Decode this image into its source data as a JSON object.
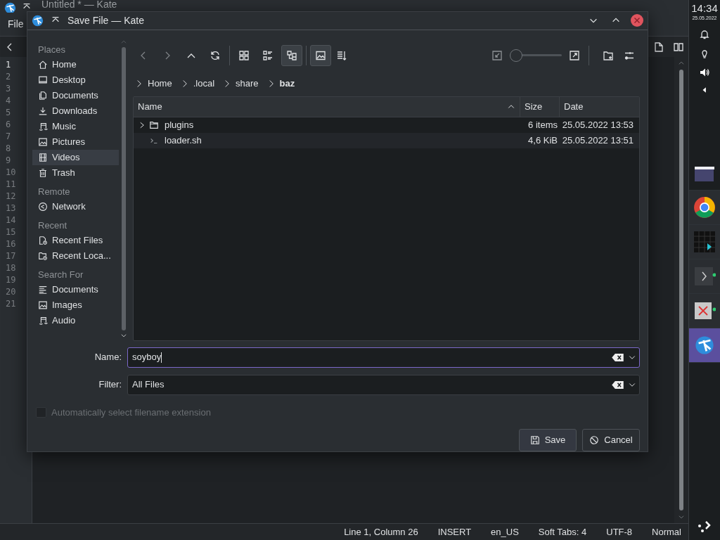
{
  "background_window": {
    "title": "Untitled * — Kate",
    "menu": [
      "File"
    ],
    "line_numbers": [
      "1",
      "2",
      "3",
      "4",
      "5",
      "6",
      "7",
      "8",
      "9",
      "10",
      "11",
      "12",
      "13",
      "14",
      "15",
      "16",
      "17",
      "18",
      "19",
      "20",
      "21"
    ],
    "status_bar": [
      "Line 1, Column 26",
      "INSERT",
      "en_US",
      "Soft Tabs: 4",
      "UTF-8",
      "Normal"
    ]
  },
  "tray": {
    "time": "14:34",
    "date": "25.05.2022"
  },
  "launchers": [
    {
      "active": false
    },
    {
      "active": false
    },
    {
      "active": false
    },
    {
      "active": false
    },
    {
      "active": false
    },
    {
      "active": true
    }
  ],
  "dialog": {
    "title": "Save File — Kate",
    "places": [
      {
        "heading": "Places",
        "items": [
          {
            "label": "Home",
            "hovered": false
          },
          {
            "label": "Desktop",
            "hovered": false
          },
          {
            "label": "Documents",
            "hovered": false
          },
          {
            "label": "Downloads",
            "hovered": false
          },
          {
            "label": "Music",
            "hovered": false
          },
          {
            "label": "Pictures",
            "hovered": false
          },
          {
            "label": "Videos",
            "hovered": true
          },
          {
            "label": "Trash",
            "hovered": false
          }
        ]
      },
      {
        "heading": "Remote",
        "items": [
          {
            "label": "Network",
            "hovered": false
          }
        ]
      },
      {
        "heading": "Recent",
        "items": [
          {
            "label": "Recent Files",
            "hovered": false
          },
          {
            "label": "Recent Loca...",
            "hovered": false
          }
        ]
      },
      {
        "heading": "Search For",
        "items": [
          {
            "label": "Documents",
            "hovered": false
          },
          {
            "label": "Images",
            "hovered": false
          },
          {
            "label": "Audio",
            "hovered": false
          }
        ]
      }
    ],
    "view_buttons": [
      {
        "pressed": false
      },
      {
        "pressed": false
      },
      {
        "pressed": true
      }
    ],
    "preview_pressed": true,
    "zoom": {
      "level": 0
    },
    "breadcrumb": [
      {
        "label": "Home",
        "current": false
      },
      {
        "label": ".local",
        "current": false
      },
      {
        "label": "share",
        "current": false
      },
      {
        "label": "baz",
        "current": true
      }
    ],
    "columns": [
      {
        "label": "Name",
        "sorted": true
      },
      {
        "label": "Size",
        "sorted": false
      },
      {
        "label": "Date",
        "sorted": false
      }
    ],
    "rows": [
      {
        "kind": "folder",
        "name": "plugins",
        "expanded": false,
        "size": "6 items",
        "date": "25.05.2022 13:53"
      },
      {
        "kind": "file",
        "name": "loader.sh",
        "size": "4,6 KiB",
        "date": "25.05.2022 13:51"
      }
    ],
    "name_field": {
      "label": "Name:",
      "value": "soyboy",
      "focused": true
    },
    "filter_field": {
      "label": "Filter:",
      "value": "All Files"
    },
    "auto_extension": {
      "label": "Automatically select filename extension",
      "checked": false,
      "disabled": true
    },
    "buttons": [
      {
        "kind": "save",
        "label": "Save"
      },
      {
        "kind": "cancel",
        "label": "Cancel"
      }
    ]
  }
}
